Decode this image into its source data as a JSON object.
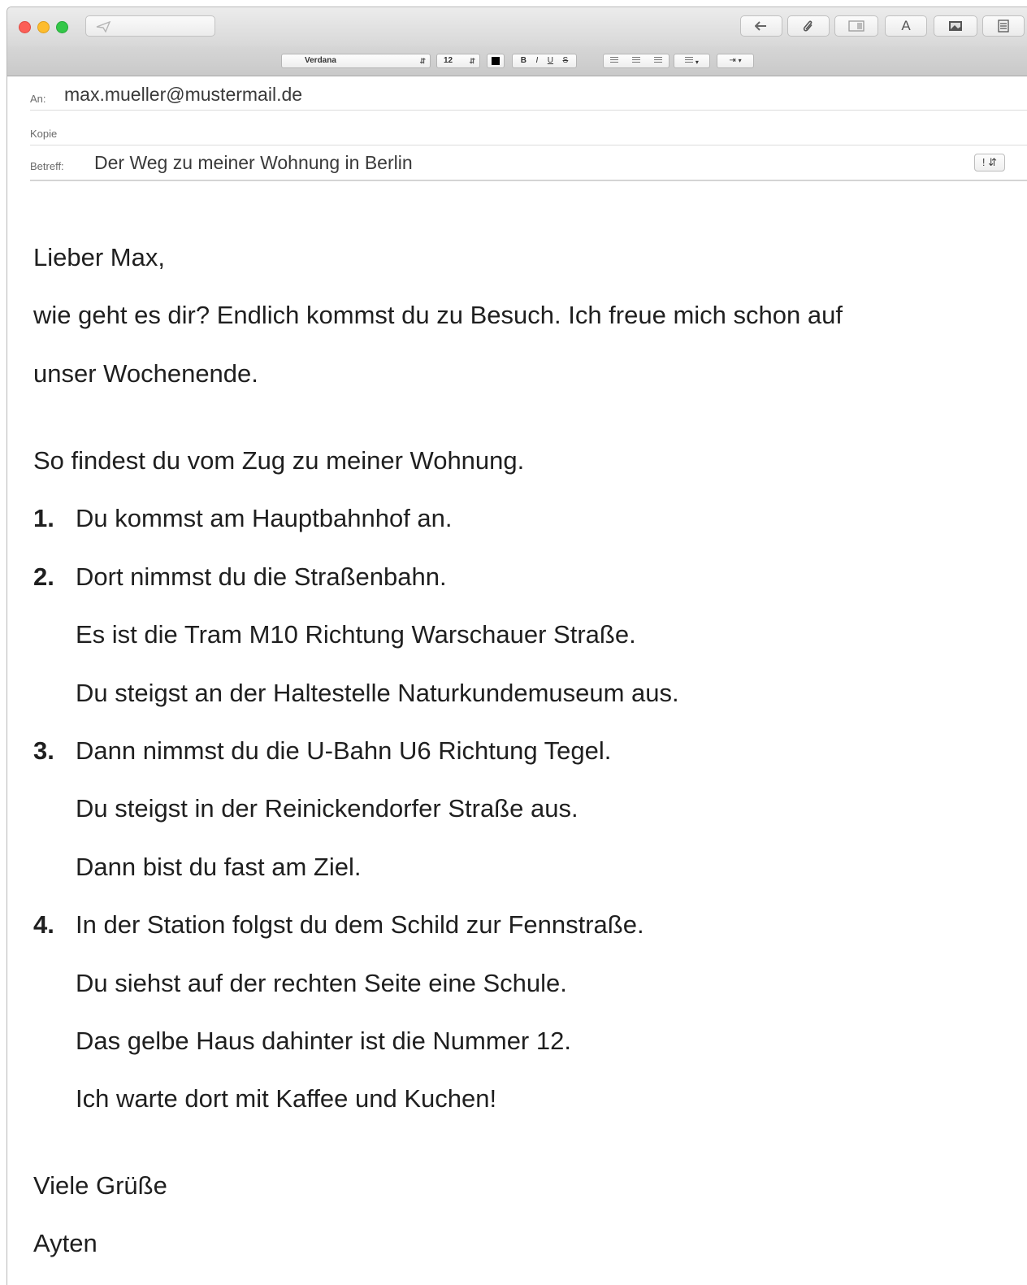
{
  "toolbar": {
    "send_icon": "paper-plane-icon",
    "reply_icon": "reply-arrow-icon",
    "attach_icon": "paperclip-icon",
    "header_icon": "header-fields-icon",
    "font_icon": "A",
    "photo_icon": "photo-browser-icon",
    "stationery_icon": "stationery-icon"
  },
  "format": {
    "font": "Verdana",
    "size": "12",
    "color": "#000000",
    "bold": "B",
    "italic": "I",
    "underline": "U",
    "strike": "S"
  },
  "headers": {
    "to_label": "An:",
    "to_value": "max.mueller@mustermail.de",
    "cc_label": "Kopie",
    "subject_label": "Betreff:",
    "subject_value": "Der Weg zu meiner Wohnung in Berlin",
    "priority": "!"
  },
  "body": {
    "greeting": "Lieber Max,",
    "line1": "wie geht es dir? Endlich kommst du zu Besuch. Ich freue mich schon auf",
    "line2": "unser Wochenende.",
    "intro": "So findest du vom Zug zu meiner Wohnung.",
    "steps": [
      {
        "num": "1.",
        "lines": [
          "Du kommst am Hauptbahnhof an."
        ]
      },
      {
        "num": "2.",
        "lines": [
          "Dort nimmst du die Straßenbahn.",
          "Es ist die Tram M10 Richtung Warschauer Straße.",
          "Du steigst an der Haltestelle Naturkundemuseum aus."
        ]
      },
      {
        "num": "3.",
        "lines": [
          "Dann nimmst du die U-Bahn U6 Richtung Tegel.",
          "Du steigst in der Reinickendorfer Straße aus.",
          "Dann bist du fast am Ziel."
        ]
      },
      {
        "num": "4.",
        "lines": [
          "In der Station folgst du dem Schild zur Fennstraße.",
          "Du siehst auf der rechten Seite eine Schule.",
          "Das gelbe Haus dahinter ist die Nummer 12.",
          "Ich warte dort mit Kaffee und Kuchen!"
        ]
      }
    ],
    "closing": "Viele Grüße",
    "signature": "Ayten"
  }
}
